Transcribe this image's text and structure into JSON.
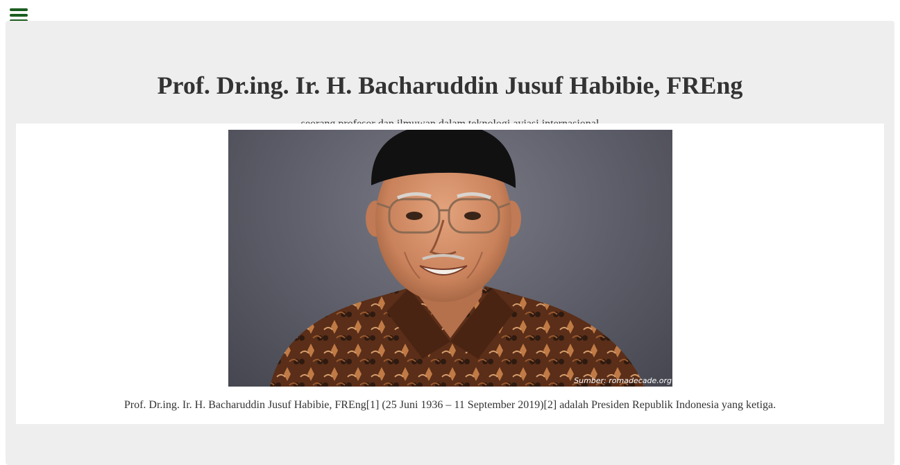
{
  "nav": {
    "menu_icon": "hamburger-menu-icon",
    "accent_color": "#1b5e20"
  },
  "header": {
    "title": "Prof. Dr.ing. Ir. H. Bacharuddin Jusuf Habibie, FREng",
    "subtitle": "seorang profesor dan ilmuwan dalam teknologi aviasi internasional"
  },
  "image": {
    "source_credit": "Sumber: romadecade.org",
    "caption": "Prof. Dr.ing. Ir. H. Bacharuddin Jusuf Habibie, FREng[1] (25 Juni 1936 – 11 September 2019)[2] adalah Presiden Republik Indonesia yang ketiga."
  },
  "colors": {
    "page_background": "#ffffff",
    "panel_background": "#eeeeee",
    "text": "#333333"
  }
}
